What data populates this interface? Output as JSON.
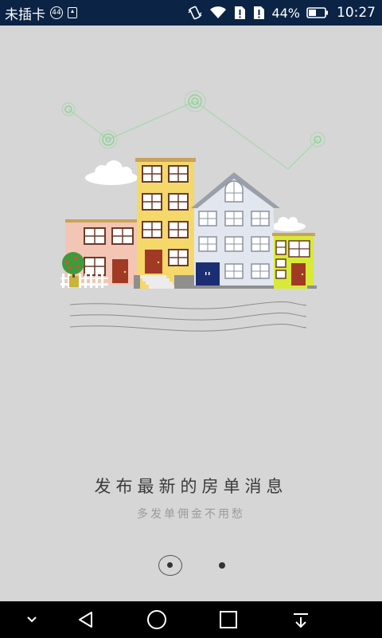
{
  "status_bar": {
    "carrier": "未插卡",
    "badge": "44",
    "battery_percent": "44%",
    "time": "10:27",
    "icons": [
      "upload-icon",
      "vibrate-icon",
      "wifi-icon",
      "sim-alert-icon",
      "sim-alert-icon",
      "battery-icon"
    ]
  },
  "onboarding": {
    "title": "发布最新的房单消息",
    "subtitle": "多发单佣金不用愁",
    "page_indicator": {
      "total": 2,
      "current": 1
    }
  },
  "nav_bar": {
    "icons": [
      "collapse-chevron-icon",
      "back-icon",
      "home-icon",
      "recents-icon",
      "notification-pull-icon"
    ]
  },
  "colors": {
    "status_bar_bg": "#0b2344",
    "background": "#d6d6d6",
    "house_pink": "#f3c5b5",
    "house_yellow": "#f5d86a",
    "house_gray": "#e2e6ee",
    "house_lime": "#d7ea3a",
    "door_red": "#a13a25",
    "door_blue": "#1c2e73",
    "accent_green": "#7fd18a"
  }
}
